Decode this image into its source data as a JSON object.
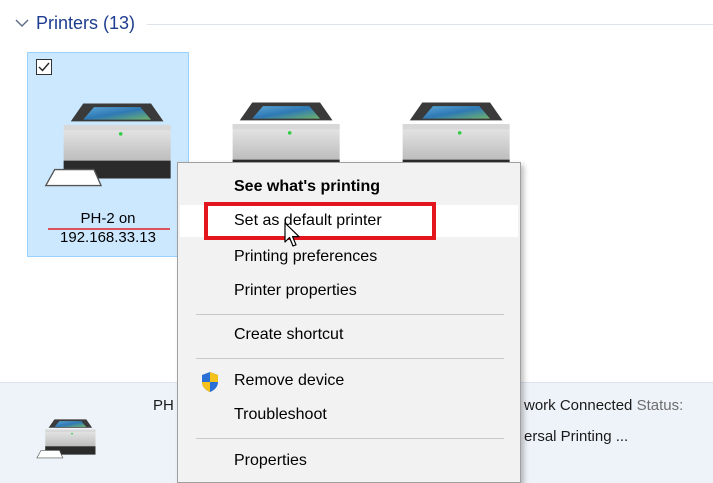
{
  "group": {
    "title": "Printers (13)"
  },
  "devices": [
    {
      "line1": "PH-2 on",
      "line2": "192.168.33.13",
      "selected": true,
      "checked": true
    },
    {
      "line1": "",
      "line2": "",
      "selected": false
    },
    {
      "line1": "",
      "line2": "",
      "selected": false
    }
  ],
  "details": {
    "name_fragment": "PH",
    "status_left": "work Connected",
    "status_label": "Status:",
    "model_fragment": "ersal Printing ..."
  },
  "context_menu": {
    "items": [
      {
        "label": "See what's printing",
        "bold": true
      },
      {
        "label": "Set as default printer",
        "highlighted": true
      },
      {
        "label": "Printing preferences"
      },
      {
        "label": "Printer properties"
      },
      {
        "label": "Create shortcut"
      },
      {
        "label": "Remove device",
        "icon": "uac-shield-icon"
      },
      {
        "label": "Troubleshoot"
      },
      {
        "label": "Properties"
      }
    ]
  },
  "colors": {
    "selection_bg": "#cce8ff",
    "selection_border": "#99d1ff",
    "annotation_red": "#e3151f",
    "header_text": "#1e3d8f"
  }
}
